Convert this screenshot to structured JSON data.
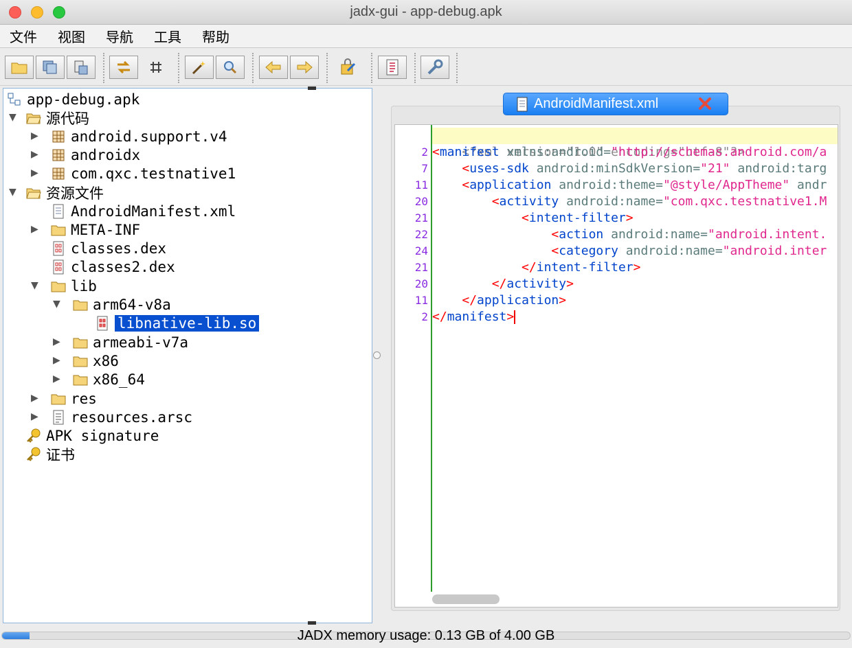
{
  "window": {
    "title": "jadx-gui - app-debug.apk"
  },
  "menu": [
    "文件",
    "视图",
    "导航",
    "工具",
    "帮助"
  ],
  "toolbar": {
    "buttons": [
      "open-file-icon",
      "save-all-icon",
      "export-icon",
      "sync-icon",
      "flatten-icon",
      "wand-icon",
      "search-icon",
      "back-icon",
      "forward-icon",
      "decompile-icon",
      "log-icon",
      "preferences-icon"
    ]
  },
  "tree": {
    "root": "app-debug.apk",
    "source_code": "源代码",
    "packages": [
      "android.support.v4",
      "androidx",
      "com.qxc.testnative1"
    ],
    "resources": "资源文件",
    "manifest": "AndroidManifest.xml",
    "meta_inf": "META-INF",
    "classes": "classes.dex",
    "classes2": "classes2.dex",
    "lib": "lib",
    "arm64": "arm64-v8a",
    "libnative": "libnative-lib.so",
    "armeabi": "armeabi-v7a",
    "x86": "x86",
    "x86_64": "x86_64",
    "res": "res",
    "arsc": "resources.arsc",
    "apk_signature": "APK signature",
    "certificate": "证书"
  },
  "editor": {
    "tab_label": "AndroidManifest.xml",
    "line_numbers": [
      "",
      "2",
      "7",
      "11",
      "20",
      "21",
      "22",
      "24",
      "21",
      "20",
      "11",
      "2"
    ],
    "lines": {
      "l0": "<?xml version=\"1.0\" encoding=\"utf-8\"?>",
      "l1_tag": "manifest",
      "l1_attr": " xmlns:android=",
      "l1_val": "\"http://schemas.android.com/a",
      "l2_tag": "uses-sdk",
      "l2_attr": " android:minSdkVersion=",
      "l2_val": "\"21\"",
      "l2_attr2": " android:targ",
      "l3_tag": "application",
      "l3_attr": " android:theme=",
      "l3_val": "\"@style/AppTheme\"",
      "l3_attr2": " andr",
      "l4_tag": "activity",
      "l4_attr": " android:name=",
      "l4_val": "\"com.qxc.testnative1.M",
      "l5_tag": "intent-filter",
      "l6_tag": "action",
      "l6_attr": " android:name=",
      "l6_val": "\"android.intent.",
      "l7_tag": "category",
      "l7_attr": " android:name=",
      "l7_val": "\"android.inter",
      "l8_tag": "intent-filter",
      "l9_tag": "activity",
      "l10_tag": "application",
      "l11_tag": "manifest"
    }
  },
  "status": {
    "memory_text": "JADX memory usage: 0.13 GB of 4.00 GB",
    "memory_fraction": 0.0325
  },
  "colors": {
    "selection": "#0950d0",
    "tab": "#1a7ff2",
    "gutter_line": "#2a9d2a",
    "xml_tag": "#0044cc",
    "xml_value": "#e0278d",
    "bracket": "#ff0000"
  }
}
